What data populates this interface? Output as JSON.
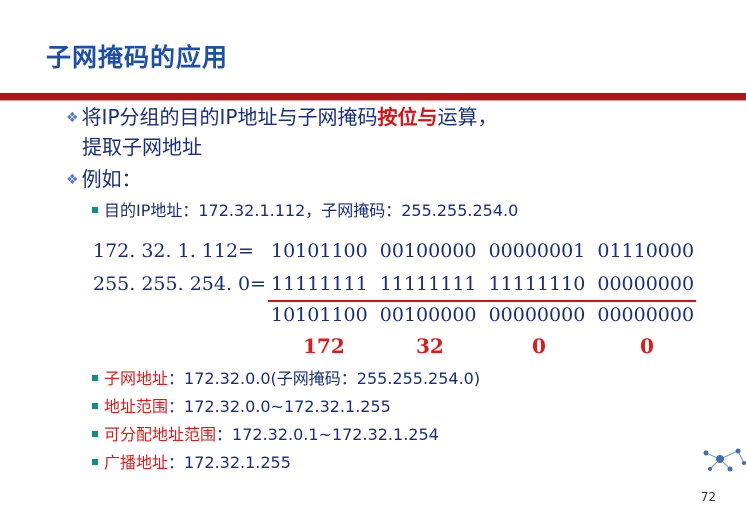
{
  "title": "子网掩码的应用",
  "bullet1": {
    "line1_pre": "将IP分组的目的IP地址与子网掩码",
    "line1_highlight": "按位与",
    "line1_post": "运算，",
    "line2": "提取子网地址"
  },
  "bullet2": "例如：",
  "example": "目的IP地址：172.32.1.112，子网掩码：255.255.254.0",
  "calc": {
    "row1_label": "172. 32. 1. 112=",
    "row1_bits": "10101100  00100000  00000001  01110000",
    "row2_label": "255. 255. 254. 0=",
    "row2_bits": "11111111  11111111  11111110  00000000",
    "row3_bits": "10101100  00100000  00000000  00000000",
    "decimals": [
      "172",
      "32",
      "0",
      "0"
    ]
  },
  "results": [
    {
      "label": "子网地址",
      "value": "：172.32.0.0(子网掩码：255.255.254.0)"
    },
    {
      "label": "地址范围",
      "value": "：172.32.0.0~172.32.1.255"
    },
    {
      "label": "可分配地址范围",
      "value": "：172.32.0.1~172.32.1.254"
    },
    {
      "label": "广播地址",
      "value": "：172.32.1.255"
    }
  ],
  "page_number": "72",
  "colors": {
    "title": "#1f4fa8",
    "accent_red": "#d41414",
    "body": "#1a2e80",
    "bullet_square": "#0d8f86"
  }
}
